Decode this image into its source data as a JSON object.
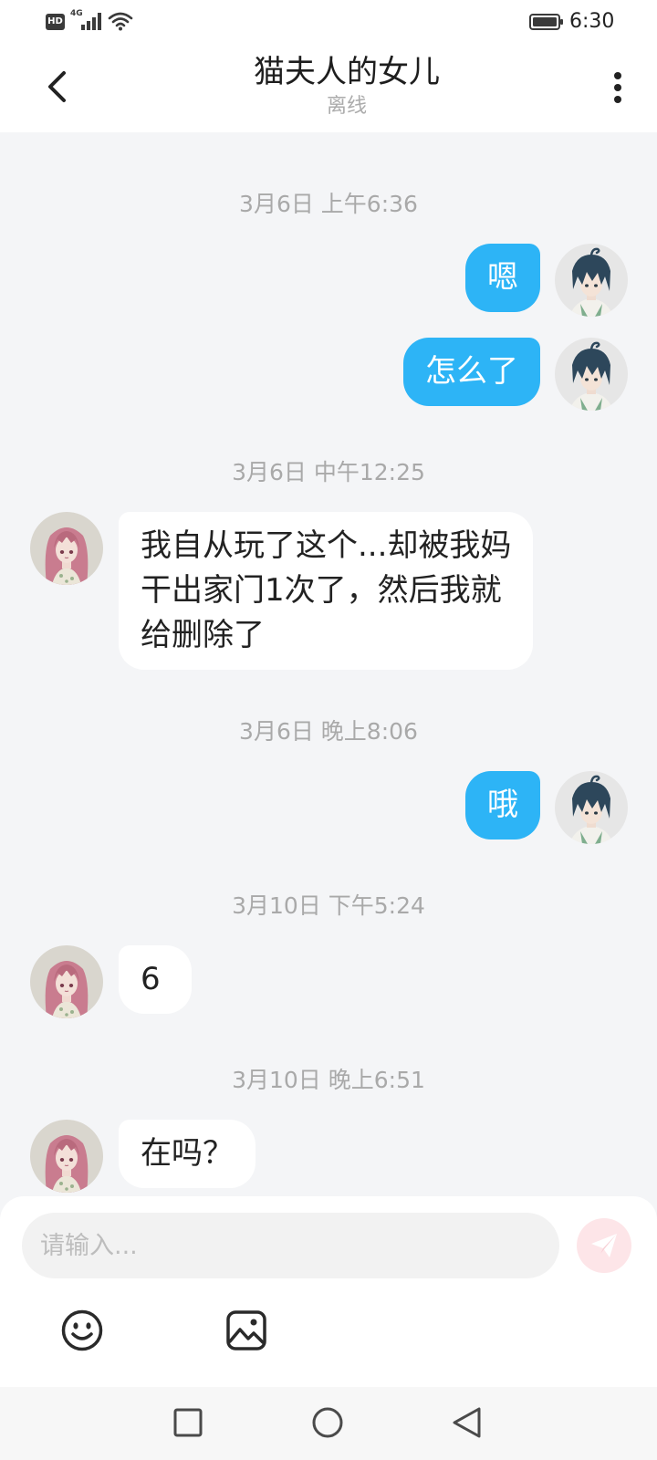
{
  "status_bar": {
    "hd_badge": "HD",
    "network_type": "4G",
    "time": "6:30",
    "icons": [
      "signal-icon",
      "wifi-icon",
      "battery-icon"
    ]
  },
  "header": {
    "title": "猫夫人的女儿",
    "status": "离线",
    "back_icon": "chevron-left-icon",
    "menu_icon": "more-vertical-icon"
  },
  "avatars": {
    "me": "blue-haired-boy-avatar",
    "contact": "pink-haired-girl-avatar"
  },
  "messages": [
    {
      "type": "timestamp",
      "text": "3月6日 上午6:36"
    },
    {
      "type": "outgoing",
      "from": "me",
      "text": "嗯"
    },
    {
      "type": "outgoing",
      "from": "me",
      "text": "怎么了"
    },
    {
      "type": "timestamp",
      "text": "3月6日 中午12:25"
    },
    {
      "type": "incoming",
      "from": "contact",
      "text": "我自从玩了这个...却被我妈\n干出家门1次了，然后我就\n给删除了"
    },
    {
      "type": "timestamp",
      "text": "3月6日 晚上8:06"
    },
    {
      "type": "outgoing",
      "from": "me",
      "text": "哦"
    },
    {
      "type": "timestamp",
      "text": "3月10日 下午5:24"
    },
    {
      "type": "incoming",
      "from": "contact",
      "text": "6"
    },
    {
      "type": "timestamp",
      "text": "3月10日 晚上6:51"
    },
    {
      "type": "incoming",
      "from": "contact",
      "text": "在吗？"
    }
  ],
  "composer": {
    "placeholder": "请输入...",
    "send_icon": "paper-plane-send-icon",
    "emoji_icon": "smiley-face-icon",
    "image_icon": "image-picture-icon"
  },
  "nav_bar": {
    "icons": [
      "recent-apps-square-icon",
      "home-circle-icon",
      "back-triangle-icon"
    ]
  },
  "colors": {
    "outgoing_bubble": "#2db4f6",
    "incoming_bubble": "#ffffff",
    "chat_background": "#f4f5f7",
    "send_button": "#fde5e8"
  }
}
